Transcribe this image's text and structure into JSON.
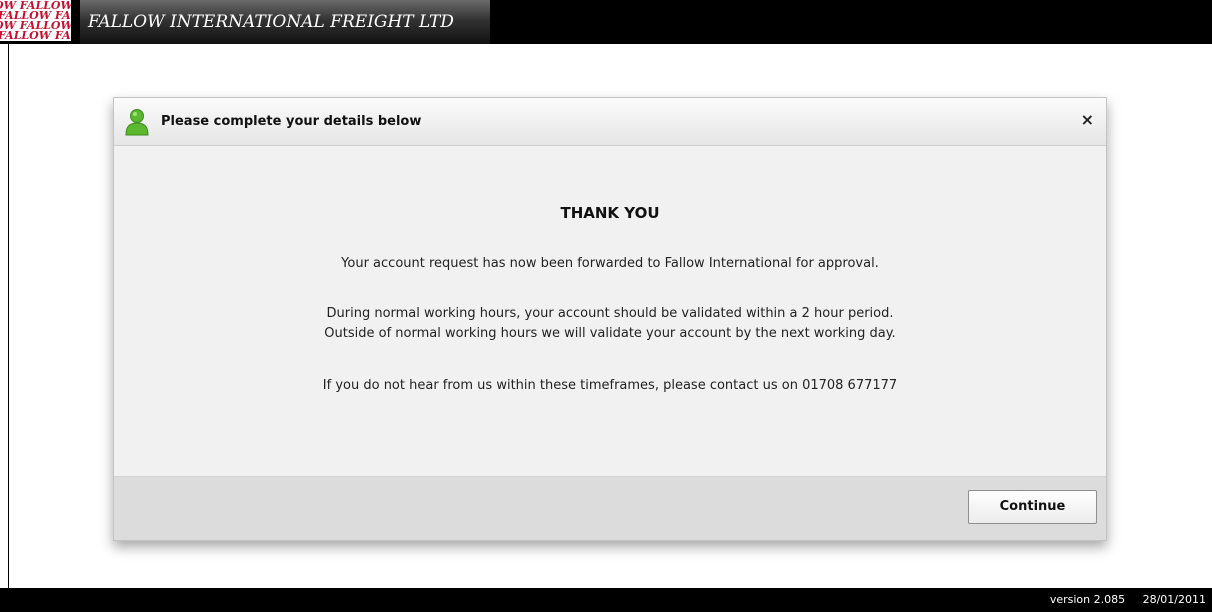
{
  "header": {
    "logo_text": "FALLOW FALLOW FALLOW FALLOW",
    "company_name": "FALLOW INTERNATIONAL FREIGHT LTD"
  },
  "dialog": {
    "title": "Please complete your details below",
    "close_label": "×",
    "heading": "THANK YOU",
    "message_1": "Your account request has now been forwarded to Fallow International for approval.",
    "message_2_line_1": "During normal working hours, your account should be validated within a 2 hour period.",
    "message_2_line_2": "Outside of normal working hours we will validate your account by the next working day.",
    "message_3": "If you do not hear from us within these timeframes, please contact us on 01708 677177",
    "continue_label": "Continue"
  },
  "footer": {
    "version": "version 2.085",
    "date": "28/01/2011"
  },
  "colors": {
    "logo_red": "#c8102e",
    "user_icon_green": "#5cb82e"
  }
}
